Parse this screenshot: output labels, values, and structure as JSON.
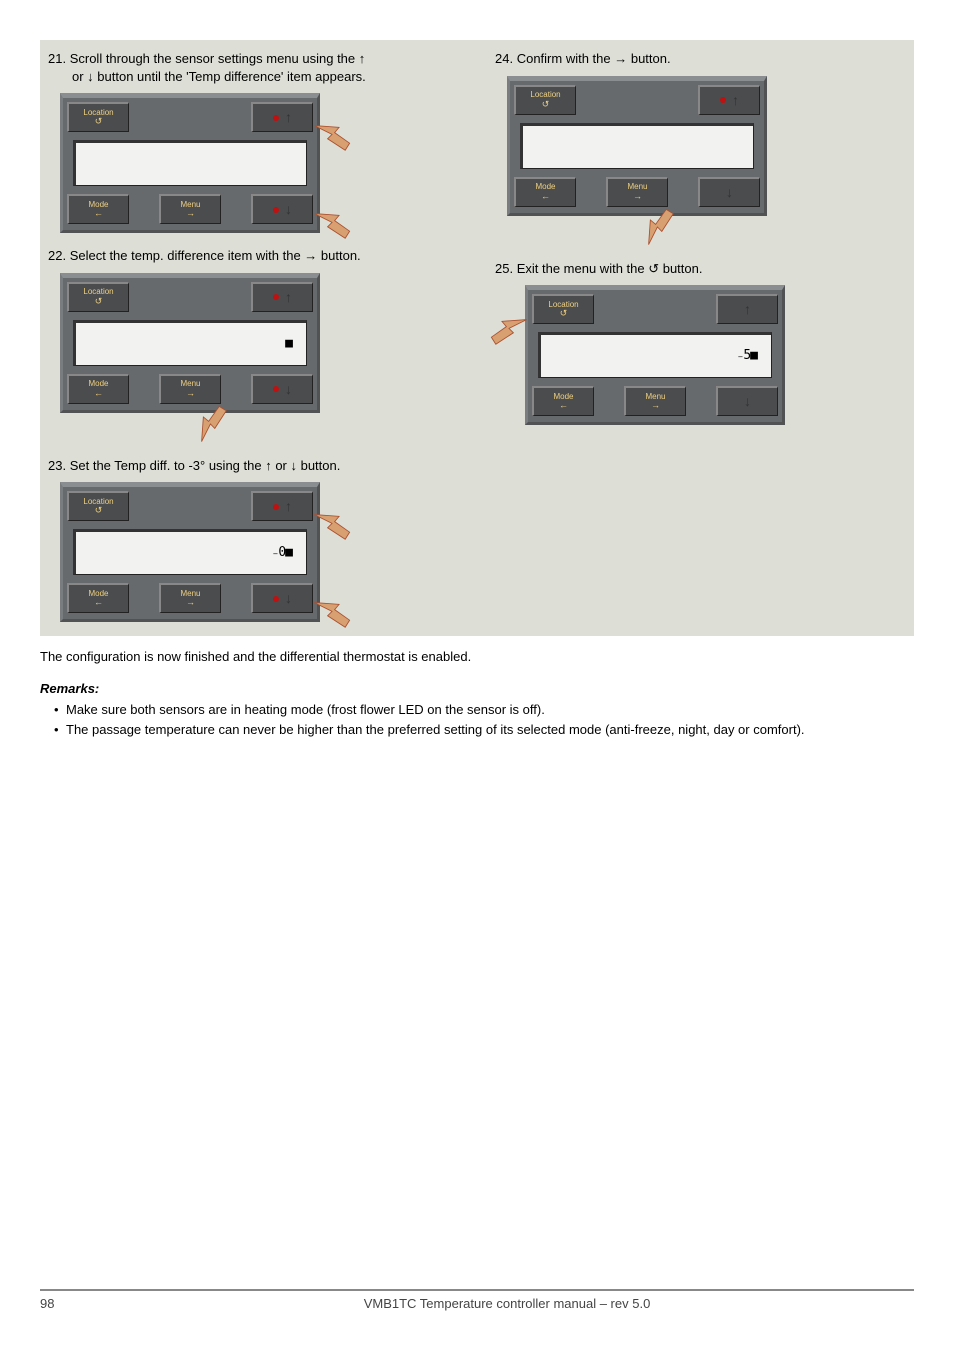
{
  "steps": {
    "s21": {
      "num": "21.",
      "text_a": "Scroll through the sensor settings menu using the ↑",
      "text_b": "or ↓ button until the 'Temp difference' item appears."
    },
    "s22": {
      "num": "22.",
      "text": "Select the temp. difference item with the → button."
    },
    "s23": {
      "num": "23.",
      "text": "Set the Temp diff. to -3° using the ↑ or ↓ button."
    },
    "s24": {
      "num": "24.",
      "text": "Confirm with the → button."
    },
    "s25": {
      "num": "25.",
      "text": "Exit the menu with the ↺ button."
    }
  },
  "panel": {
    "location_label": "Location",
    "location_sym": "↺",
    "mode_label": "Mode",
    "mode_sym": "←",
    "menu_label": "Menu",
    "menu_sym": "→",
    "up_sym": "↑",
    "down_sym": "↓",
    "lcd_21": " ",
    "lcd_22": "■",
    "lcd_23": "₋0■",
    "lcd_24": " ",
    "lcd_25": "₋5■"
  },
  "post": {
    "finished": "The configuration is now finished and the differential thermostat is enabled.",
    "remarks_head": "Remarks:",
    "remark1": "Make sure both sensors are in heating mode (frost flower LED on the sensor is off).",
    "remark2": "The passage temperature can never be higher than the preferred setting of its selected mode (anti-freeze, night, day or comfort)."
  },
  "footer": {
    "page": "98",
    "title": "VMB1TC Temperature controller manual – rev 5.0"
  }
}
